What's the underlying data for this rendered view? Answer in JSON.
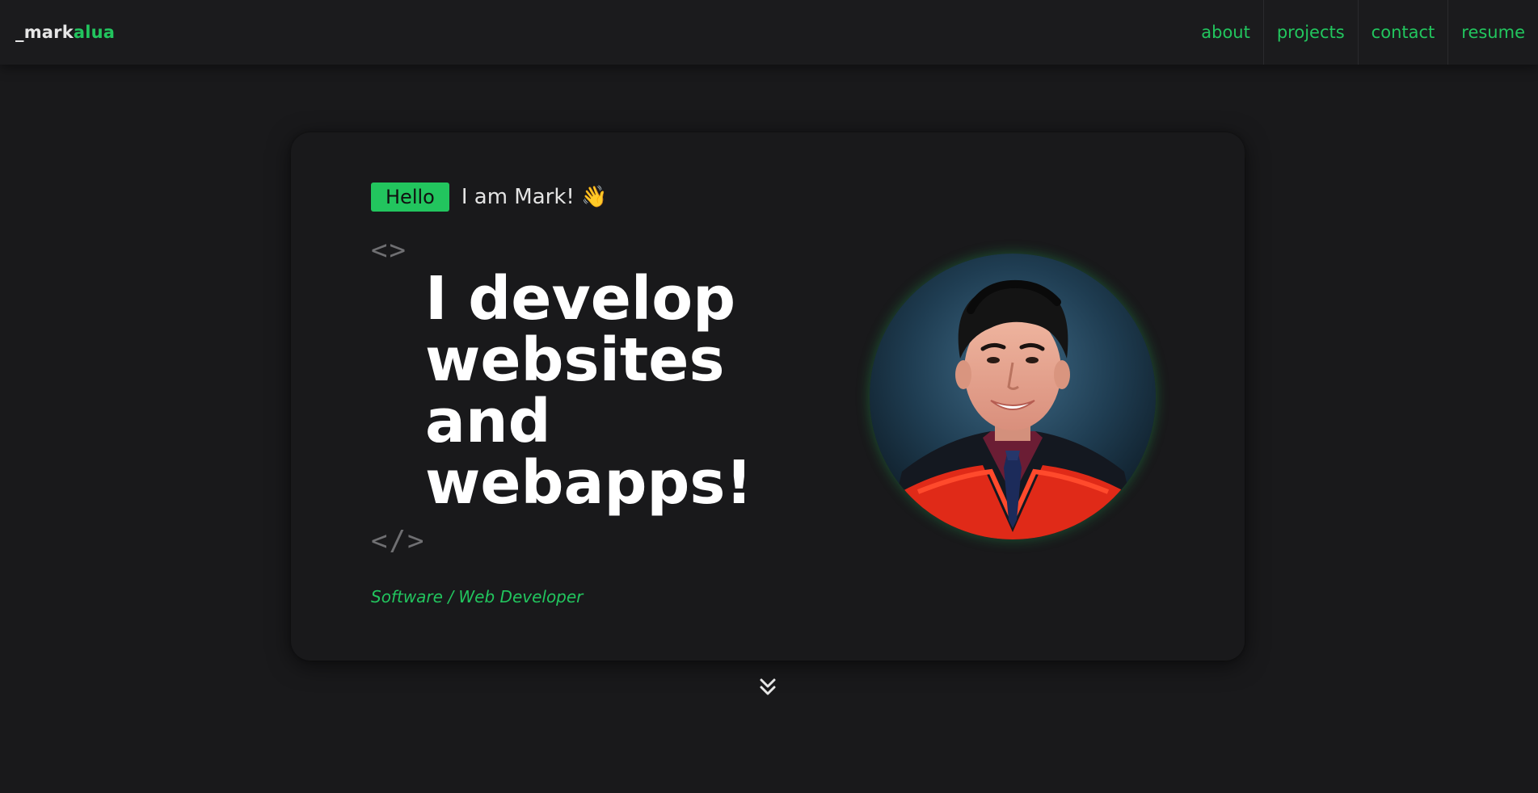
{
  "nav": {
    "logo_prefix": "_mark",
    "logo_suffix": "alua",
    "links": [
      {
        "label": "about"
      },
      {
        "label": "projects"
      },
      {
        "label": "contact"
      },
      {
        "label": "resume"
      }
    ]
  },
  "hero": {
    "badge": "Hello",
    "intro": "I am Mark! 👋",
    "tag_open": "<>",
    "tag_close": "</>",
    "headline_lines": [
      "I develop",
      "websites",
      "and",
      "webapps!"
    ],
    "role": "Software / Web Developer"
  },
  "colors": {
    "accent": "#22c55e",
    "background": "#19191b",
    "heading": "#ffffff",
    "muted": "#6f6f72"
  },
  "icons": {
    "scroll": "double-chevron-down-icon",
    "wave": "waving-hand-emoji"
  }
}
